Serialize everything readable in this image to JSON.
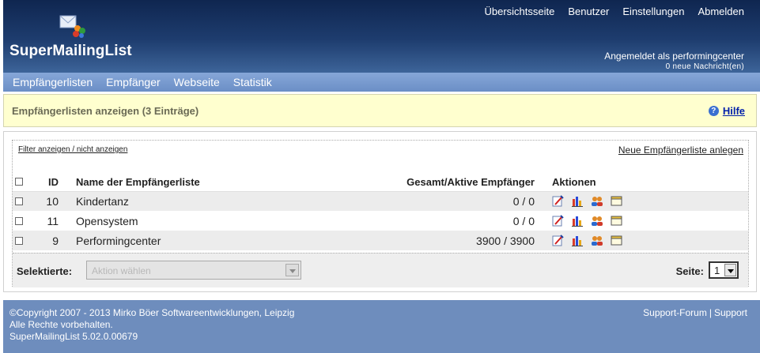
{
  "app": {
    "brand": "SuperMailingList"
  },
  "topnav": [
    "Übersichtsseite",
    "Benutzer",
    "Einstellungen",
    "Abmelden"
  ],
  "user": {
    "logged_in": "Angemeldet als performingcenter",
    "messages": "0 neue Nachricht(en)"
  },
  "menu": [
    "Empfängerlisten",
    "Empfänger",
    "Webseite",
    "Statistik"
  ],
  "page": {
    "title": "Empfängerlisten anzeigen (3 Einträge)",
    "help": "Hilfe"
  },
  "panel": {
    "filter_link": "Filter anzeigen / nicht anzeigen",
    "new_link": "Neue Empfängerliste anlegen"
  },
  "table": {
    "headers": [
      "ID",
      "Name der Empfängerliste",
      "Gesamt/Aktive Empfänger",
      "Aktionen"
    ],
    "rows": [
      {
        "id": "10",
        "name": "Kindertanz",
        "total": "0 / 0"
      },
      {
        "id": "11",
        "name": "Opensystem",
        "total": "0 / 0"
      },
      {
        "id": "9",
        "name": "Performingcenter",
        "total": "3900 / 3900"
      }
    ]
  },
  "bulk": {
    "label": "Selektierte:",
    "placeholder": "Aktion wählen"
  },
  "pagination": {
    "label": "Seite:",
    "value": "1"
  },
  "footer": {
    "copyright": "©Copyright 2007 - 2013 Mirko Böer Softwareentwicklungen, Leipzig",
    "rights": "Alle Rechte vorbehalten.",
    "version": "SuperMailingList 5.02.0.00679",
    "forum": "Support-Forum",
    "sep": "|",
    "support": "Support"
  },
  "colors": {
    "header_top": "#0f2650",
    "menu": "#6b8fc6",
    "title_band": "#ffffcf",
    "footer": "#6e8dbd"
  }
}
